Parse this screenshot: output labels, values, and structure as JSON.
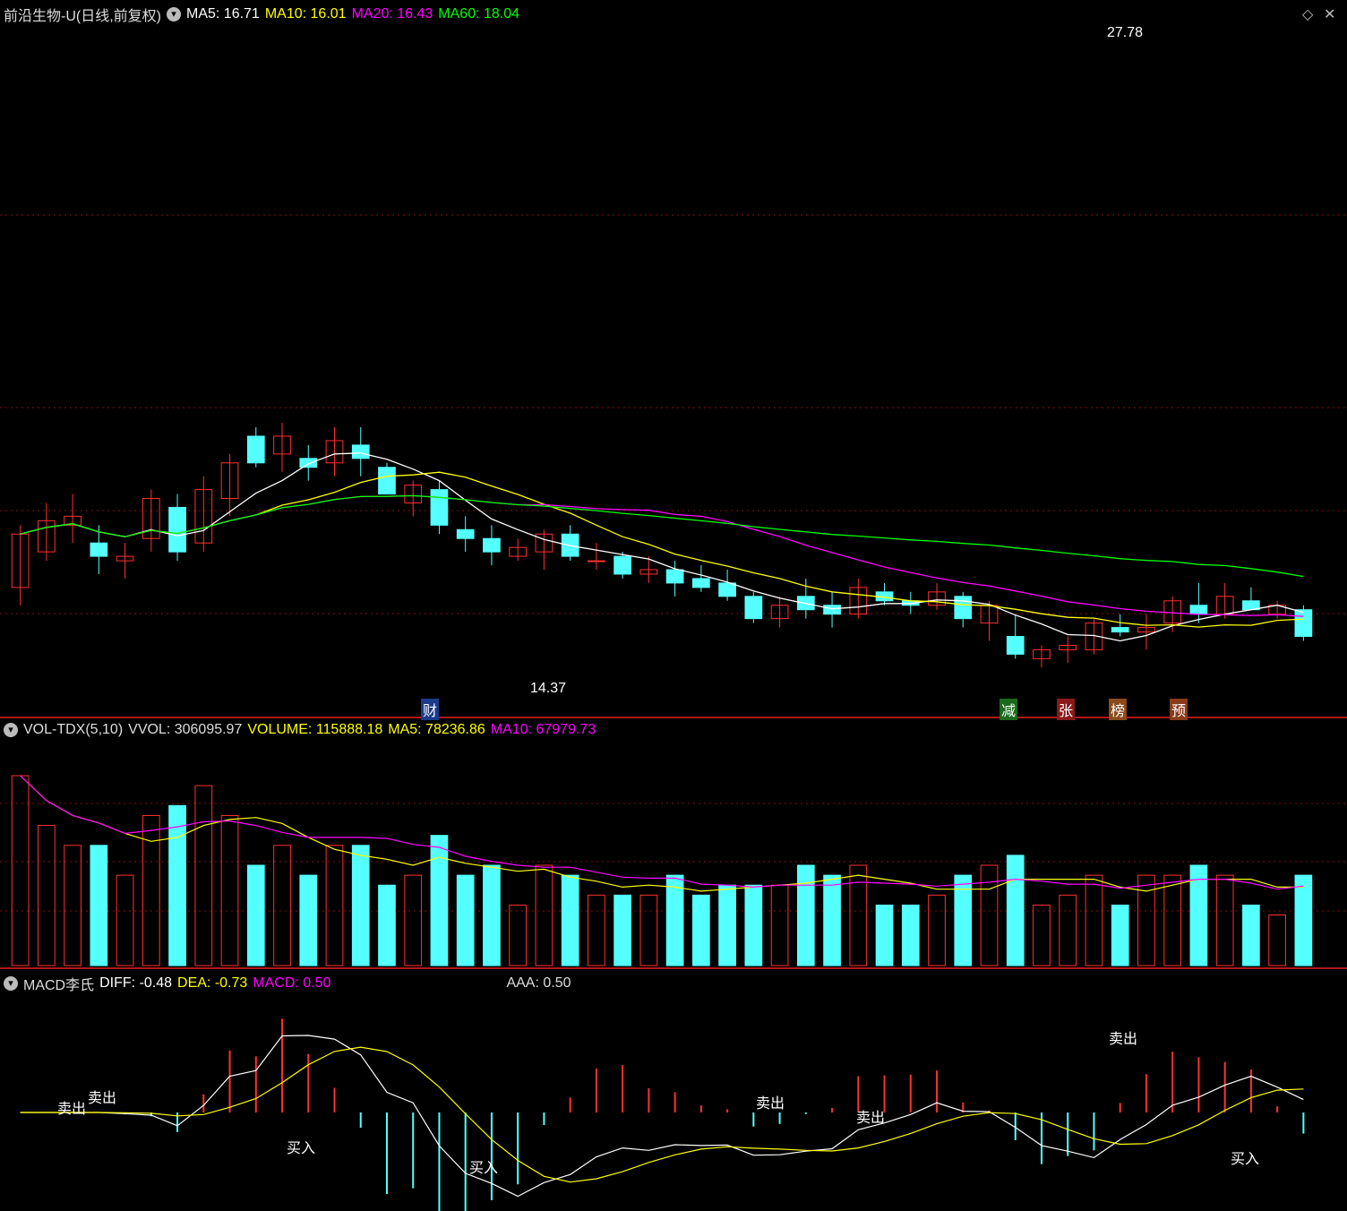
{
  "price_panel": {
    "title": "前沿生物-U(日线,前复权)",
    "ma5_label": "MA5: 16.71",
    "ma10_label": "MA10: 16.01",
    "ma20_label": "MA20: 16.43",
    "ma60_label": "MA60: 18.04",
    "high_label": "27.78",
    "low_label": "14.37",
    "event_markers": [
      "财",
      "减",
      "张",
      "榜",
      "预"
    ],
    "colors": {
      "up": "#ff3030",
      "down": "#54ffff",
      "ma5": "#ffffff",
      "ma10": "#ffff00",
      "ma20": "#ff00ff",
      "ma60": "#00ff00"
    }
  },
  "volume_panel": {
    "title": "VOL-TDX(5,10)",
    "vvol_label": "VVOL: 306095.97",
    "volume_label": "VOLUME: 115888.18",
    "ma5_label": "MA5: 78236.86",
    "ma10_label": "MA10: 67979.73"
  },
  "macd_panel": {
    "title": "MACD李氏",
    "diff_label": "DIFF: -0.48",
    "dea_label": "DEA: -0.73",
    "macd_label": "MACD: 0.50",
    "aaa_label": "AAA: 0.50",
    "sell_label": "卖出",
    "buy_label": "买入"
  },
  "chart_data": {
    "type": "candlestick",
    "ylim": [
      13.5,
      29.0
    ],
    "ohlc": [
      [
        16.2,
        17.6,
        15.8,
        17.4
      ],
      [
        17.0,
        18.1,
        16.8,
        17.7
      ],
      [
        17.6,
        18.3,
        17.2,
        17.8
      ],
      [
        17.2,
        17.6,
        16.5,
        16.9
      ],
      [
        16.8,
        17.2,
        16.4,
        16.9
      ],
      [
        17.3,
        18.4,
        17.0,
        18.2
      ],
      [
        18.0,
        18.3,
        16.8,
        17.0
      ],
      [
        17.2,
        18.7,
        17.0,
        18.4
      ],
      [
        18.2,
        19.2,
        17.8,
        19.0
      ],
      [
        19.6,
        19.8,
        18.9,
        19.0
      ],
      [
        19.2,
        19.9,
        18.8,
        19.6
      ],
      [
        19.1,
        19.4,
        18.6,
        18.9
      ],
      [
        19.0,
        19.8,
        18.7,
        19.5
      ],
      [
        19.4,
        19.8,
        18.7,
        19.1
      ],
      [
        18.9,
        19.0,
        18.3,
        18.3
      ],
      [
        18.1,
        18.6,
        17.8,
        18.5
      ],
      [
        18.4,
        18.6,
        17.4,
        17.6
      ],
      [
        17.5,
        17.8,
        17.0,
        17.3
      ],
      [
        17.3,
        17.6,
        16.7,
        17.0
      ],
      [
        16.9,
        17.3,
        16.8,
        17.1
      ],
      [
        17.0,
        17.5,
        16.6,
        17.4
      ],
      [
        17.4,
        17.6,
        16.8,
        16.9
      ],
      [
        16.8,
        17.2,
        16.6,
        16.8
      ],
      [
        16.9,
        17.0,
        16.4,
        16.5
      ],
      [
        16.5,
        16.9,
        16.3,
        16.6
      ],
      [
        16.6,
        16.8,
        16.0,
        16.3
      ],
      [
        16.4,
        16.7,
        16.1,
        16.2
      ],
      [
        16.3,
        16.6,
        15.9,
        16.0
      ],
      [
        16.0,
        16.1,
        15.4,
        15.5
      ],
      [
        15.5,
        16.0,
        15.3,
        15.8
      ],
      [
        16.0,
        16.4,
        15.5,
        15.7
      ],
      [
        15.8,
        16.1,
        15.3,
        15.6
      ],
      [
        15.6,
        16.4,
        15.5,
        16.2
      ],
      [
        16.1,
        16.3,
        15.8,
        15.9
      ],
      [
        15.9,
        16.1,
        15.6,
        15.8
      ],
      [
        15.8,
        16.3,
        15.7,
        16.1
      ],
      [
        16.0,
        16.1,
        15.3,
        15.5
      ],
      [
        15.4,
        15.9,
        15.0,
        15.8
      ],
      [
        15.1,
        15.6,
        14.6,
        14.7
      ],
      [
        14.6,
        14.9,
        14.4,
        14.8
      ],
      [
        14.8,
        15.1,
        14.5,
        14.9
      ],
      [
        14.8,
        15.5,
        14.7,
        15.4
      ],
      [
        15.3,
        15.6,
        15.1,
        15.2
      ],
      [
        15.2,
        15.6,
        14.8,
        15.3
      ],
      [
        15.4,
        16.0,
        15.2,
        15.9
      ],
      [
        15.8,
        16.3,
        15.4,
        15.6
      ],
      [
        15.6,
        16.3,
        15.5,
        16.0
      ],
      [
        15.9,
        16.2,
        15.7,
        15.7
      ],
      [
        15.6,
        15.9,
        15.5,
        15.8
      ],
      [
        15.7,
        15.8,
        15.0,
        15.1
      ]
    ]
  }
}
